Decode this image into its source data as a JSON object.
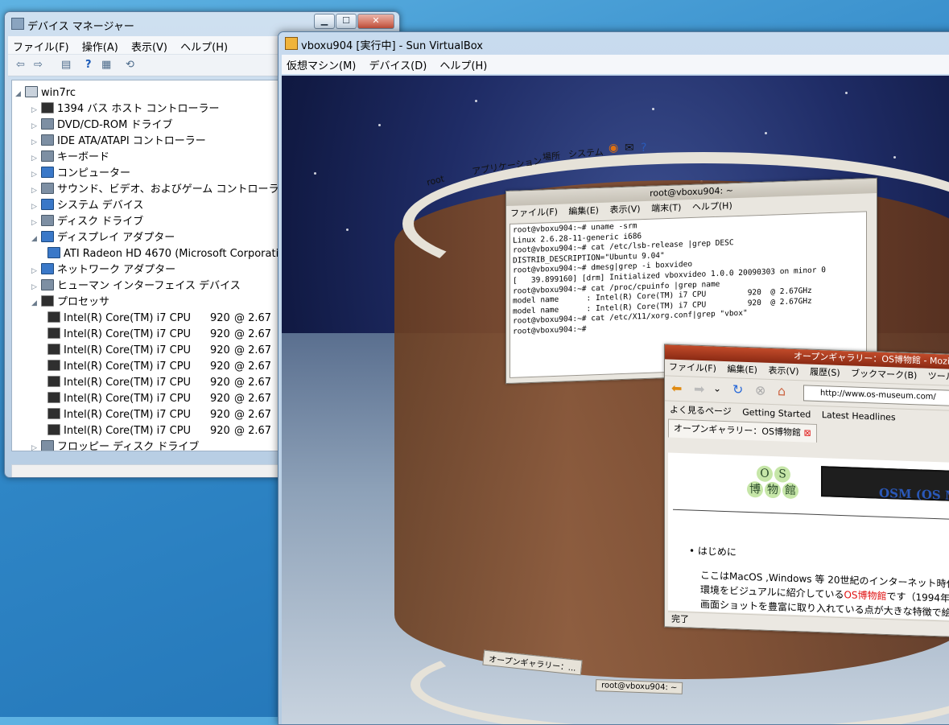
{
  "device_manager": {
    "title": "デバイス マネージャー",
    "menu": [
      "ファイル(F)",
      "操作(A)",
      "表示(V)",
      "ヘルプ(H)"
    ],
    "root": "win7rc",
    "categories": [
      "1394 バス ホスト コントローラー",
      "DVD/CD-ROM ドライブ",
      "IDE ATA/ATAPI コントローラー",
      "キーボード",
      "コンピューター",
      "サウンド、ビデオ、およびゲーム コントローラー",
      "システム デバイス",
      "ディスク ドライブ",
      "ディスプレイ アダプター"
    ],
    "display_child": "ATI Radeon HD 4670 (Microsoft Corporation",
    "categories2": [
      "ネットワーク アダプター",
      "ヒューマン インターフェイス デバイス",
      "プロセッサ"
    ],
    "cpu_name": "Intel(R) Core(TM) i7 CPU",
    "cpu_model": "920",
    "cpu_freq": "@ 2.67",
    "cpu_count_label": "8",
    "last_category": "フロッピー ディスク ドライブ"
  },
  "virtualbox": {
    "title": "vboxu904 [実行中] - Sun VirtualBox",
    "menu": [
      "仮想マシン(M)",
      "デバイス(D)",
      "ヘルプ(H)"
    ]
  },
  "gnome_panel": {
    "apps": "アプリケーション",
    "places": "場所",
    "system": "システム",
    "root_label": "root"
  },
  "terminal": {
    "title": "root@vboxu904: ~",
    "menu": [
      "ファイル(F)",
      "編集(E)",
      "表示(V)",
      "端末(T)",
      "ヘルプ(H)"
    ],
    "lines": [
      "root@vboxu904:~# uname -srm",
      "Linux 2.6.28-11-generic i686",
      "root@vboxu904:~# cat /etc/lsb-release |grep DESC",
      "DISTRIB_DESCRIPTION=\"Ubuntu 9.04\"",
      "root@vboxu904:~# dmesg|grep -i boxvideo",
      "[   39.899160] [drm] Initialized vboxvideo 1.0.0 20090303 on minor 0",
      "root@vboxu904:~# cat /proc/cpuinfo |grep name",
      "model name      : Intel(R) Core(TM) i7 CPU         920  @ 2.67GHz",
      "model name      : Intel(R) Core(TM) i7 CPU         920  @ 2.67GHz",
      "root@vboxu904:~# cat /etc/X11/xorg.conf|grep \"vbox\"",
      "root@vboxu904:~# "
    ]
  },
  "firefox": {
    "title": "オープンギャラリー：OS博物館 - Mozilla Fir",
    "menu": [
      "ファイル(F)",
      "編集(E)",
      "表示(V)",
      "履歴(S)",
      "ブックマーク(B)",
      "ツール(T)"
    ],
    "url": "http://www.os-museum.com/",
    "bookmarks": [
      "よく見るページ",
      "Getting Started",
      "Latest Headlines"
    ],
    "tab": "オープンギャラリー：OS博物館",
    "badge_top": [
      "O",
      "S"
    ],
    "badge_bottom": [
      "博",
      "物",
      "館"
    ],
    "osm": "OSM (OS Mu",
    "bullet": "はじめに",
    "p1": "ここはMacOS ,Windows 等 20世紀のインターネット時代",
    "p2a": "環境をビジュアルに紹介している",
    "p2link": "OS博物館",
    "p2b": "です（1994年",
    "p3": "画面ショットを豊富に取り入れている点が大きな特徴で絵",
    "status": "完了"
  },
  "taskbar": {
    "ff_task": "オープンギャラリー：...",
    "term_task": "root@vboxu904: ~"
  }
}
